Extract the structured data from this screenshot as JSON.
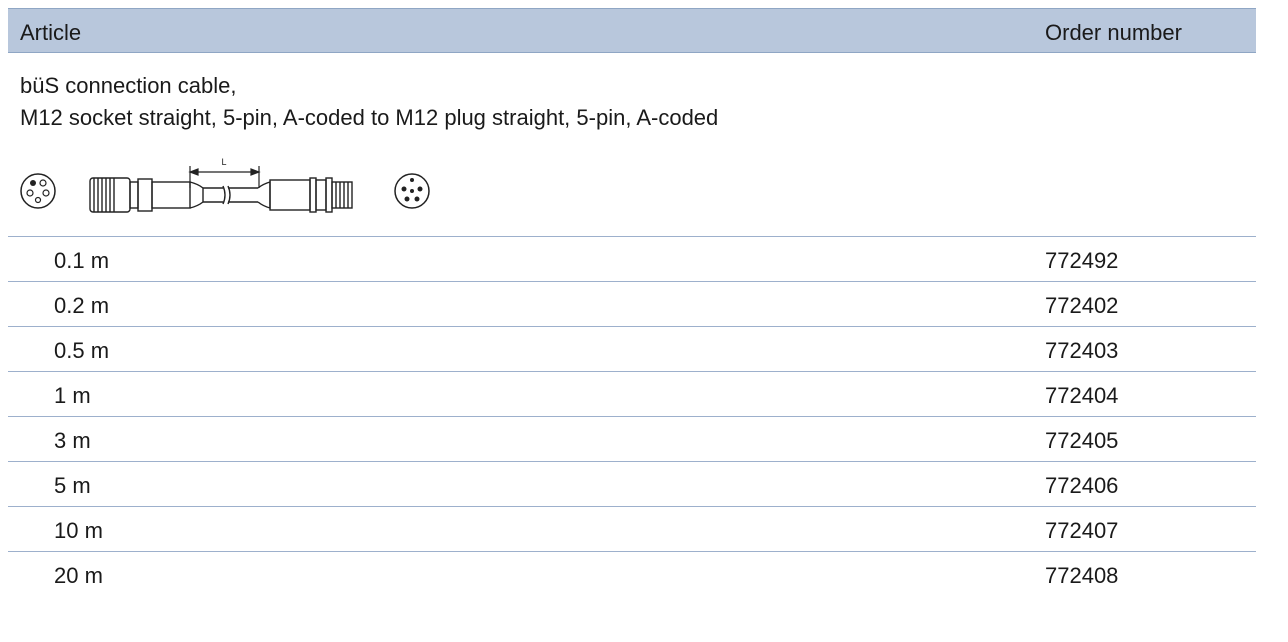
{
  "header": {
    "article": "Article",
    "order_number": "Order number"
  },
  "description": {
    "line1": "büS connection cable,",
    "line2": "M12 socket straight, 5-pin, A-coded to M12 plug straight, 5-pin, A-coded"
  },
  "diagram": {
    "dimension_label": "L"
  },
  "rows": [
    {
      "length": "0.1 m",
      "order": "772492"
    },
    {
      "length": "0.2 m",
      "order": "772402"
    },
    {
      "length": "0.5 m",
      "order": "772403"
    },
    {
      "length": "1 m",
      "order": "772404"
    },
    {
      "length": "3 m",
      "order": "772405"
    },
    {
      "length": "5 m",
      "order": "772406"
    },
    {
      "length": "10 m",
      "order": "772407"
    },
    {
      "length": "20 m",
      "order": "772408"
    }
  ]
}
